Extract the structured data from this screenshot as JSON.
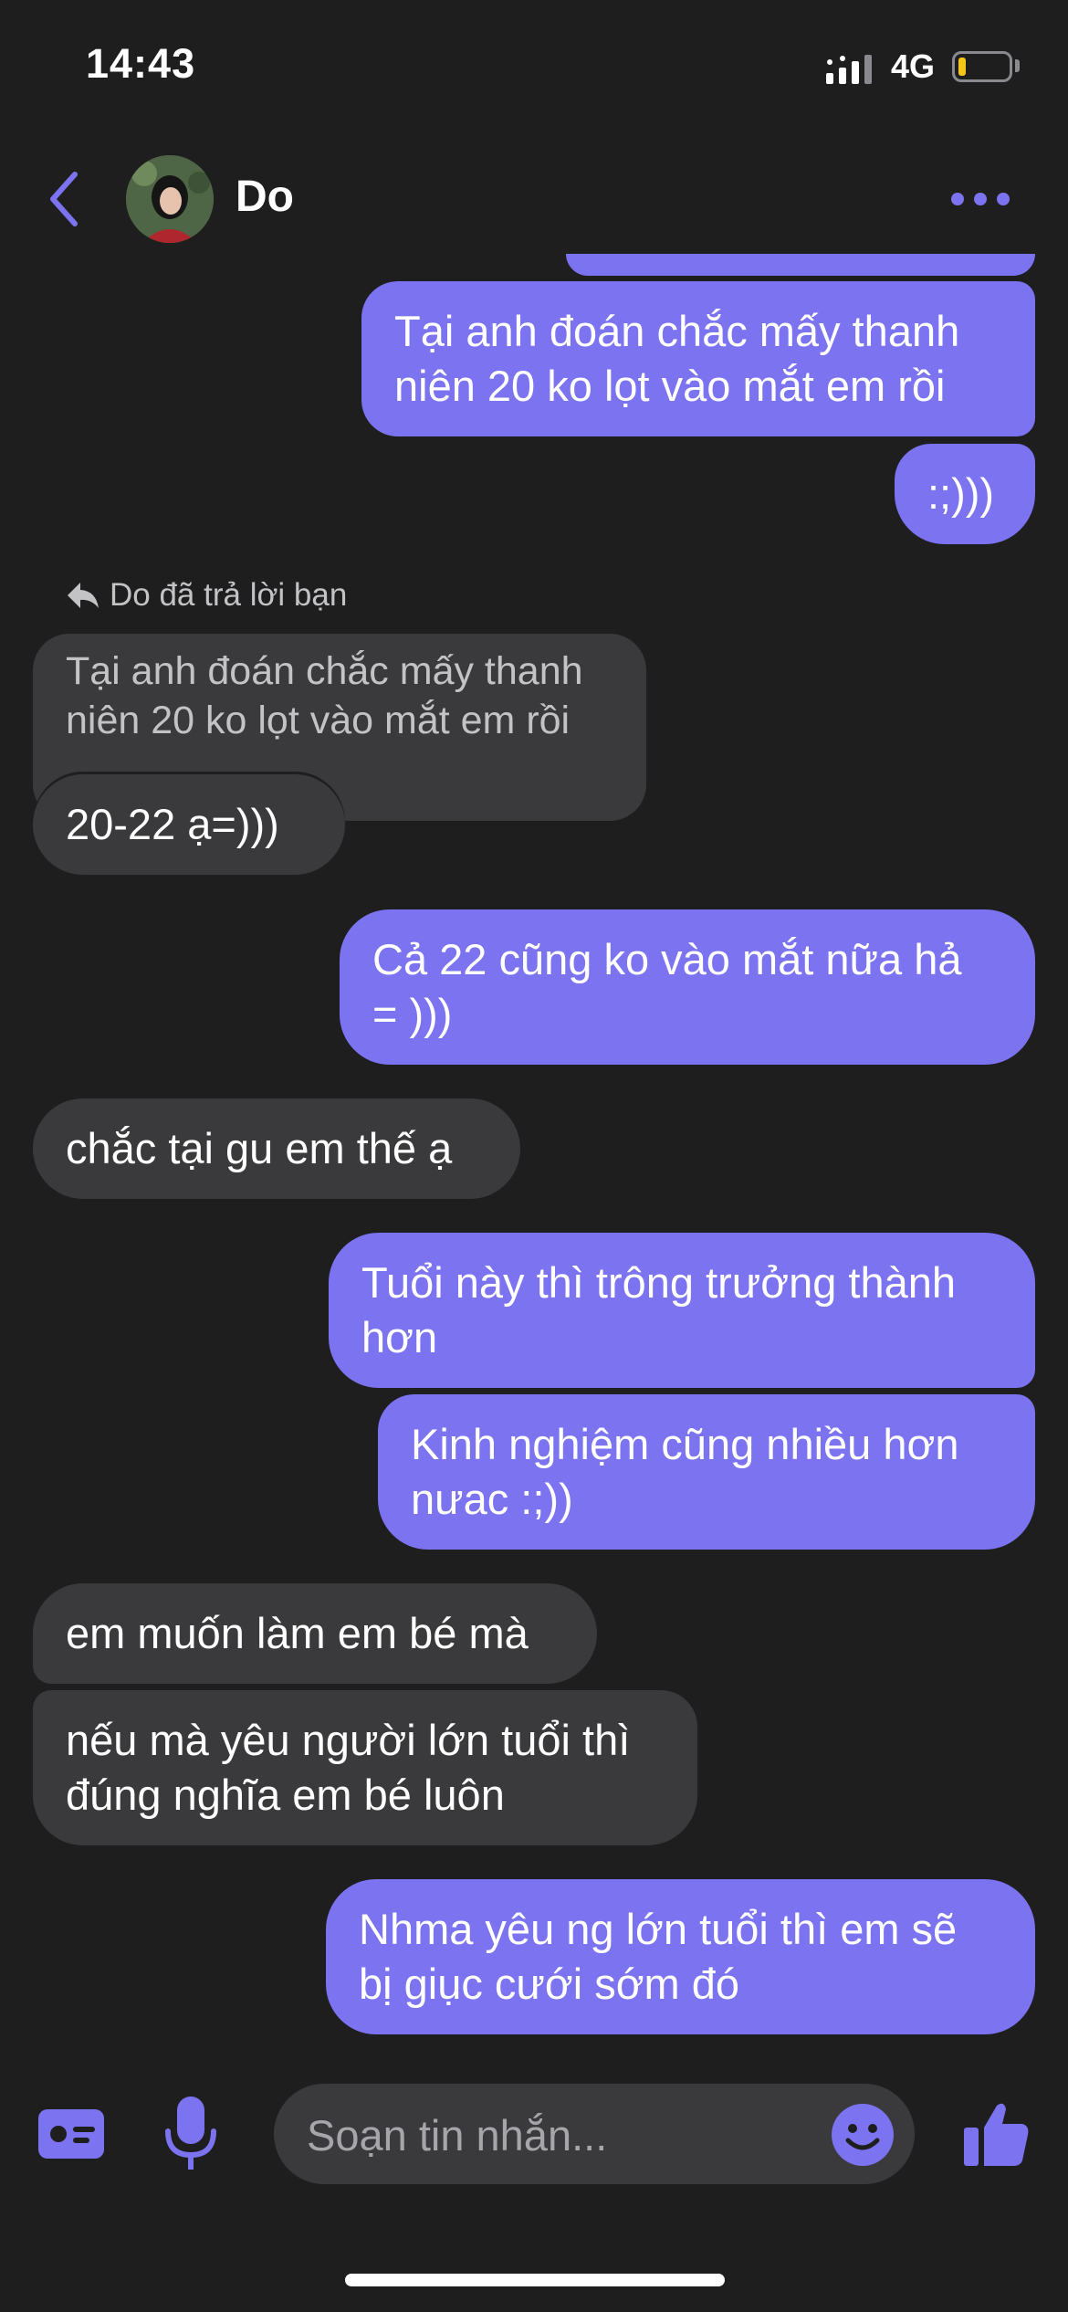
{
  "status_bar": {
    "time": "14:43",
    "network": "4G"
  },
  "header": {
    "contact_name": "Do"
  },
  "reply_note": "Do đã trả lời bạn",
  "messages": {
    "m1": {
      "lines": [
        "Tại anh đoán chắc mấy thanh",
        "niên 20 ko lọt vào mắt em rồi"
      ]
    },
    "m2": {
      "lines": [
        ":;)))"
      ]
    },
    "quote": {
      "lines": [
        "Tại anh đoán chắc mấy thanh",
        "niên 20 ko lọt vào mắt em rồi"
      ]
    },
    "m3": {
      "lines": [
        "20-22 ạ=)))"
      ]
    },
    "m4": {
      "lines": [
        "Cả 22 cũng ko vào mắt nữa hả",
        "= )))"
      ]
    },
    "m5": {
      "lines": [
        "chắc tại gu em thế ạ"
      ]
    },
    "m6": {
      "lines": [
        "Tuổi này thì trông trưởng thành",
        "hơn"
      ]
    },
    "m7": {
      "lines": [
        "Kinh nghiệm cũng nhiều hơn",
        "nưac :;))"
      ]
    },
    "m8": {
      "lines": [
        "em muốn làm em bé mà"
      ]
    },
    "m9": {
      "lines": [
        "nếu mà yêu người lớn tuổi thì",
        "đúng nghĩa em bé luôn"
      ]
    },
    "m10": {
      "lines": [
        "Nhma yêu ng lớn tuổi thì em sẽ",
        "bị giục cưới sớm đó"
      ]
    }
  },
  "composer": {
    "placeholder": "Soạn tin nhắn..."
  },
  "icons": [
    "back-chevron-icon",
    "more-dots-icon",
    "id-card-icon",
    "microphone-icon",
    "emoji-icon",
    "thumbs-up-icon",
    "reply-arrow-icon"
  ],
  "colors": {
    "accent": "#7b73f0",
    "incoming_bubble": "#3a3a3c",
    "background": "#1e1e1f"
  }
}
